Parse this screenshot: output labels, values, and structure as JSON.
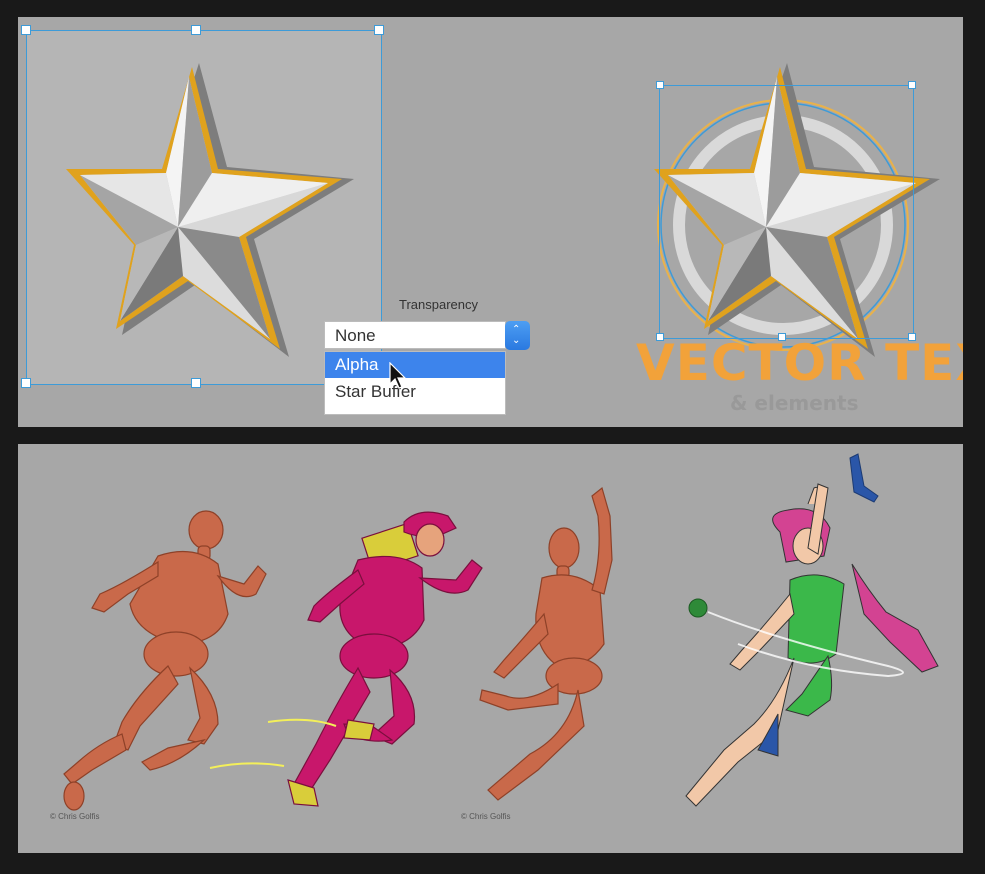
{
  "dropdown": {
    "label": "Transparency",
    "selected_value": "None",
    "options": [
      {
        "label": "Alpha",
        "highlighted": true
      },
      {
        "label": "Star Buffer",
        "highlighted": false
      }
    ]
  },
  "logo": {
    "title": "VECTOR TEXT",
    "subtitle": "& elements"
  },
  "credits": [
    {
      "text": "© Chris Golfis"
    },
    {
      "text": "© Chris Golfis"
    }
  ],
  "colors": {
    "panel_background": "#a7a7a7",
    "selection_blue": "#3d9bd8",
    "highlight_blue": "#3d84ec",
    "logo_orange": "#f2a23a",
    "star_gold": "#e0a21d",
    "figure_skin": "#c9694a",
    "superhero_magenta": "#c8176b",
    "girl_green": "#3bb84a",
    "girl_hair_pink": "#d34392"
  },
  "icons": {
    "cursor": "arrow-cursor-icon",
    "stepper": "up-down-chevron-icon"
  }
}
